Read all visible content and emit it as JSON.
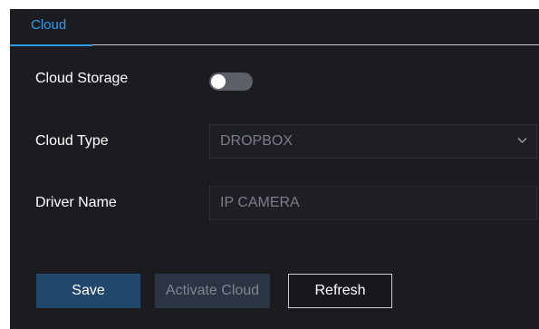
{
  "tabs": {
    "active_label": "Cloud"
  },
  "cloud_storage": {
    "label": "Cloud Storage",
    "enabled": false
  },
  "cloud_type": {
    "label": "Cloud Type",
    "value": "DROPBOX"
  },
  "driver_name": {
    "label": "Driver Name",
    "value": "IP CAMERA"
  },
  "actions": {
    "save_label": "Save",
    "activate_label": "Activate Cloud",
    "refresh_label": "Refresh"
  },
  "colors": {
    "accent": "#2e9bf0",
    "panel_bg": "#1b1c20",
    "save_bg": "#21476b"
  }
}
